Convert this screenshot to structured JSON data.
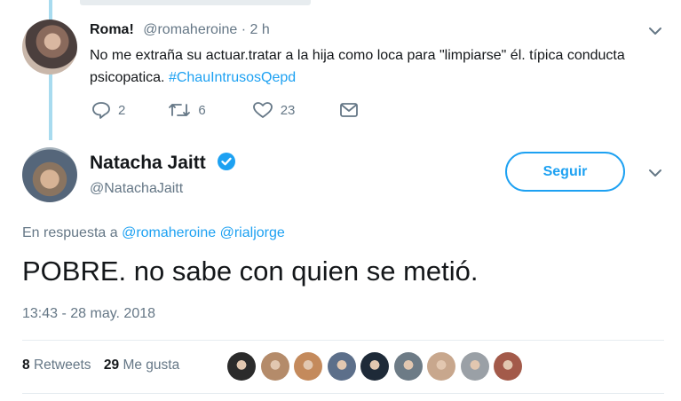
{
  "reply": {
    "display_name": "Roma!",
    "handle_time": "@romaheroine · 2 h",
    "text_main": "No me extraña su actuar.tratar a la hija como loca para \"limpiarse\" él. típica conducta psicopatica. ",
    "hashtag": "#ChauIntrusosQepd",
    "replies": "2",
    "retweets": "6",
    "likes": "23"
  },
  "tweet": {
    "display_name": "Natacha Jaitt",
    "handle": "@NatachaJaitt",
    "follow_label": "Seguir",
    "in_reply_prefix": "En respuesta a",
    "mention_1": "@romaheroine",
    "mention_2": "@rialjorge",
    "text": "POBRE. no sabe con quien se metió.",
    "timestamp": "13:43 - 28 may. 2018",
    "retweet_count": "8",
    "retweet_label": "Retweets",
    "like_count": "29",
    "like_label": "Me gusta"
  },
  "liker_colors": [
    "#2b2b2b",
    "#b48b6a",
    "#c48a5c",
    "#5c6f8a",
    "#1e2a38",
    "#6d7b86",
    "#c8a78d",
    "#9aa0a6",
    "#a35a4a"
  ],
  "colors": {
    "accent": "#1da1f2",
    "thread_line": "#a8dbef",
    "muted": "#657786"
  }
}
